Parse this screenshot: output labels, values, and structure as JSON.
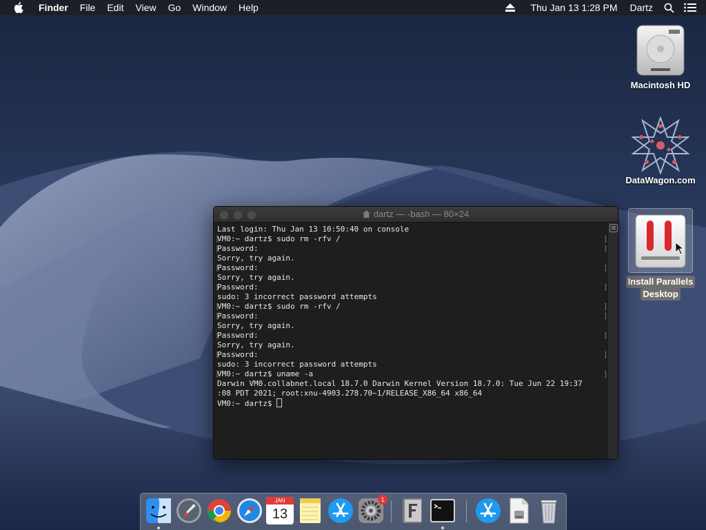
{
  "menubar": {
    "app_name": "Finder",
    "menus": [
      "File",
      "Edit",
      "View",
      "Go",
      "Window",
      "Help"
    ],
    "clock": "Thu Jan 13  1:28 PM",
    "user": "Dartz"
  },
  "desktop_icons": [
    {
      "label": "Macintosh HD",
      "icon": "hard-drive-icon"
    },
    {
      "label": "DataWagon.com",
      "icon": "datawagon-star-icon"
    },
    {
      "label_line1": "Install Parallels",
      "label_line2": "Desktop",
      "icon": "parallels-installer-icon",
      "selected": true
    }
  ],
  "terminal": {
    "title": "dartz — -bash — 80×24",
    "lines": [
      "Last login: Thu Jan 13 10:50:40 on console",
      "VM0:~ dartz$ sudo rm -rfv /",
      "Password:",
      "Sorry, try again.",
      "Password:",
      "Sorry, try again.",
      "Password:",
      "sudo: 3 incorrect password attempts",
      "VM0:~ dartz$ sudo rm -rfv /",
      "Password:",
      "Sorry, try again.",
      "Password:",
      "Sorry, try again.",
      "Password:",
      "sudo: 3 incorrect password attempts",
      "VM0:~ dartz$ uname -a",
      "Darwin VM0.collabnet.local 18.7.0 Darwin Kernel Version 18.7.0: Tue Jun 22 19:37",
      ":08 PDT 2021; root:xnu-4903.278.70~1/RELEASE_X86_64 x86_64",
      "VM0:~ dartz$ "
    ]
  },
  "dock": {
    "calendar_month": "JAN",
    "calendar_day": "13",
    "system_prefs_badge": "1",
    "items": [
      "finder-icon",
      "launchpad-icon",
      "chrome-icon",
      "safari-icon",
      "calendar-icon",
      "notes-icon",
      "app-store-icon",
      "system-preferences-icon",
      "font-book-icon",
      "terminal-icon",
      "app-store-downloads-icon",
      "preview-disk-image-icon",
      "trash-icon"
    ]
  },
  "colors": {
    "menubar_bg": "#1c1e26",
    "terminal_bg": "#1e1e1e",
    "terminal_text": "#e8e8e8",
    "badge_red": "#e0382f",
    "parallels_red": "#d8282e"
  }
}
